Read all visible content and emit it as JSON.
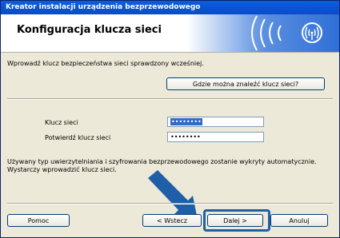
{
  "window": {
    "title": "Kreator instalacji urządzenia bezprzewodowego"
  },
  "header": {
    "title": "Konfiguracja klucza sieci",
    "icon": "wireless-signal-icon",
    "accent_color": "#2f6fd6"
  },
  "instruction": "Wprowadź klucz bezpieczeństwa sieci sprawdzony wcześniej.",
  "find_key_button": "Gdzie można znaleźć klucz sieci?",
  "form": {
    "key_label": "Klucz sieci",
    "key_value": "••••••••",
    "confirm_label": "Potwierdź klucz sieci",
    "confirm_value": "••••••••"
  },
  "info_line1": "Używany typ uwierzytelniania i szyfrowania bezprzewodowego zostanie wykryty automatycznie.",
  "info_line2": "Wystarczy wprowadzić klucz sieci.",
  "buttons": {
    "help": "Pomoc",
    "back": "< Wstecz",
    "next": "Dalej >",
    "cancel": "Anuluj"
  },
  "annotation": {
    "icon": "arrow-pointer-icon",
    "color": "#1f5fa8"
  }
}
